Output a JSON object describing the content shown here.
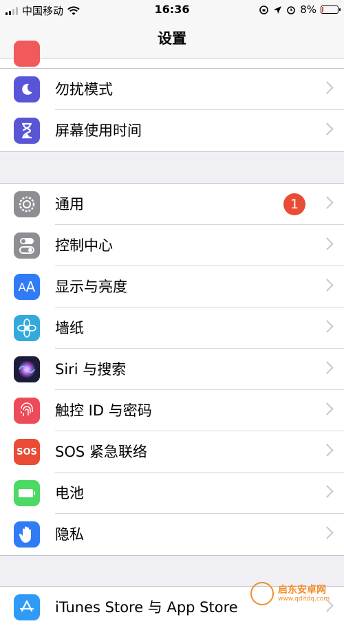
{
  "status_bar": {
    "carrier": "中国移动",
    "time": "16:36",
    "battery_percent": "8%",
    "battery_level": 0.08,
    "battery_color": "#e94b35"
  },
  "nav": {
    "title": "设置"
  },
  "groups": [
    {
      "rows": [
        {
          "label": "勿扰模式",
          "icon": "moon-icon",
          "icon_bg": "#5856d6"
        },
        {
          "label": "屏幕使用时间",
          "icon": "hourglass-icon",
          "icon_bg": "#5856d6"
        }
      ]
    },
    {
      "rows": [
        {
          "label": "通用",
          "icon": "gear-icon",
          "icon_bg": "#8e8e93",
          "badge": "1"
        },
        {
          "label": "控制中心",
          "icon": "toggles-icon",
          "icon_bg": "#8e8e93"
        },
        {
          "label": "显示与亮度",
          "icon": "text-size-icon",
          "icon_bg": "#2f7cf6"
        },
        {
          "label": "墙纸",
          "icon": "flower-icon",
          "icon_bg": "#34aadc"
        },
        {
          "label": "Siri 与搜索",
          "icon": "siri-icon",
          "icon_bg": "#1c1c3a"
        },
        {
          "label": "触控 ID 与密码",
          "icon": "fingerprint-icon",
          "icon_bg": "#ef4a5a"
        },
        {
          "label": "SOS 紧急联络",
          "icon": "sos-icon",
          "icon_bg": "#e94b35",
          "icon_text": "SOS"
        },
        {
          "label": "电池",
          "icon": "battery-icon",
          "icon_bg": "#4cd964"
        },
        {
          "label": "隐私",
          "icon": "hand-icon",
          "icon_bg": "#2f7cf6"
        }
      ]
    },
    {
      "rows": [
        {
          "label": "iTunes Store 与 App Store",
          "icon": "app-store-icon",
          "icon_bg": "#2f9bf6"
        }
      ]
    }
  ],
  "watermark": {
    "title": "启东安卓网",
    "url": "www.qdltdq.com"
  }
}
